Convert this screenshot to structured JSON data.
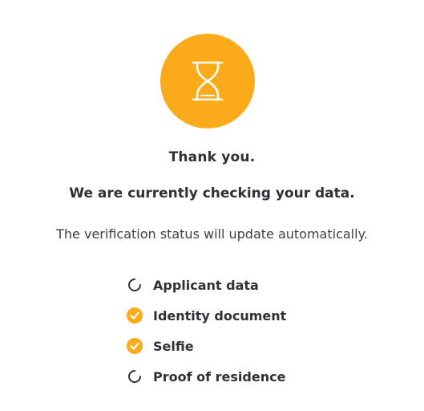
{
  "colors": {
    "accent": "#FBAA19",
    "text": "#2F3136",
    "icon_white": "#FFFFFF",
    "pending_icon": "#2F3136"
  },
  "hero": {
    "icon": "hourglass-icon"
  },
  "heading": "Thank you.",
  "subheading": "We are currently checking your data.",
  "note": "The verification status will update automatically.",
  "steps": [
    {
      "label": "Applicant data",
      "status": "pending",
      "icon": "loading-icon"
    },
    {
      "label": "Identity document",
      "status": "completed",
      "icon": "check-circle-icon"
    },
    {
      "label": "Selfie",
      "status": "completed",
      "icon": "check-circle-icon"
    },
    {
      "label": "Proof of residence",
      "status": "pending",
      "icon": "loading-icon"
    }
  ]
}
